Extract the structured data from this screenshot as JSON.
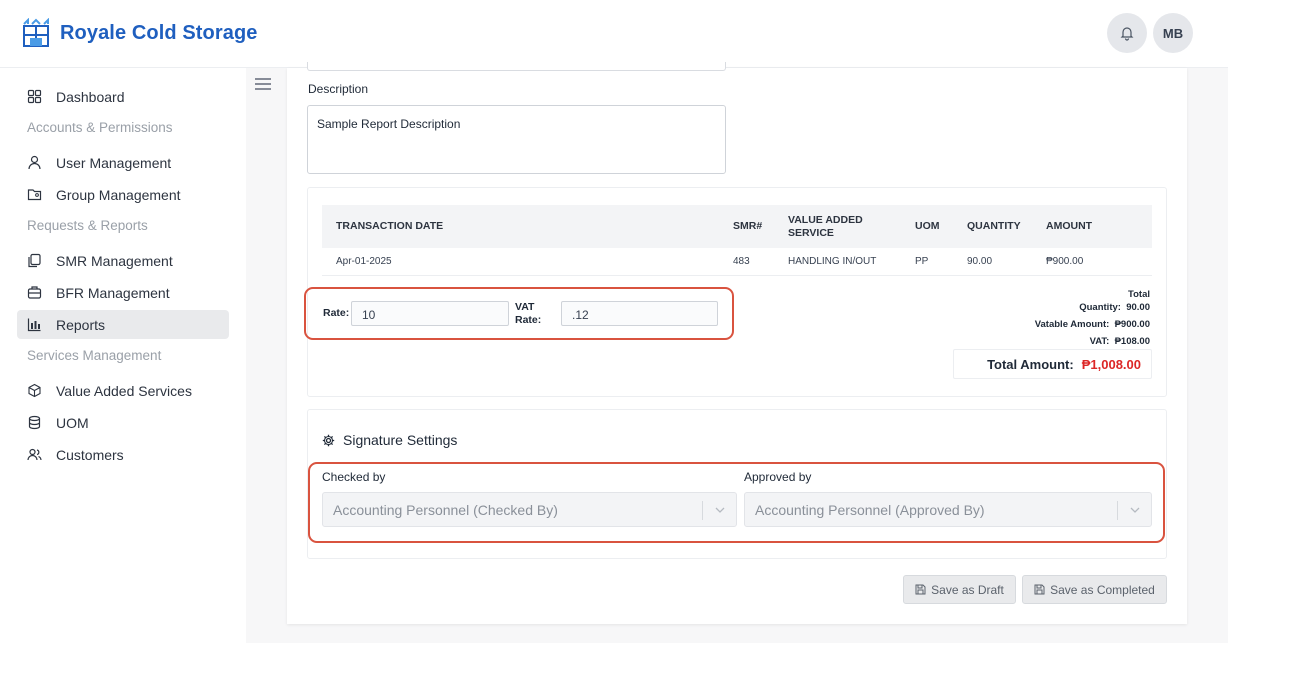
{
  "app": {
    "name": "Royale Cold Storage",
    "user_initials": "MB"
  },
  "sidebar": {
    "items": [
      {
        "label": "Dashboard",
        "icon": "dashboard-icon"
      },
      {
        "section": "Accounts & Permissions"
      },
      {
        "label": "User Management",
        "icon": "user-icon"
      },
      {
        "label": "Group Management",
        "icon": "folder-user-icon"
      },
      {
        "section": "Requests & Reports"
      },
      {
        "label": "SMR Management",
        "icon": "copy-icon"
      },
      {
        "label": "BFR Management",
        "icon": "briefcase-icon"
      },
      {
        "label": "Reports",
        "icon": "bar-chart-icon",
        "active": true
      },
      {
        "section": "Services Management"
      },
      {
        "label": "Value Added Services",
        "icon": "box-icon"
      },
      {
        "label": "UOM",
        "icon": "database-icon"
      },
      {
        "label": "Customers",
        "icon": "users-icon"
      }
    ]
  },
  "form": {
    "description_label": "Description",
    "description_value": "Sample Report Description"
  },
  "transactions": {
    "headers": [
      "TRANSACTION DATE",
      "SMR#",
      "VALUE ADDED SERVICE",
      "UOM",
      "QUANTITY",
      "AMOUNT"
    ],
    "rows": [
      [
        "Apr-01-2025",
        "483",
        "HANDLING IN/OUT",
        "PP",
        "90.00",
        "₱900.00"
      ]
    ]
  },
  "rates": {
    "rate_label": "Rate:",
    "rate_value": "10",
    "vat_label_line1": "VAT",
    "vat_label_line2": "Rate:",
    "vat_value": ".12"
  },
  "totals": {
    "total_quantity_label1": "Total",
    "total_quantity_label2": "Quantity:",
    "total_quantity": "90.00",
    "vatable_label": "Vatable Amount:",
    "vatable_amount": "₱900.00",
    "vat_label": "VAT:",
    "vat_amount": "₱108.00",
    "total_amount_label": "Total Amount:",
    "total_amount": "₱1,008.00"
  },
  "signature": {
    "title": "Signature Settings",
    "checked_by_label": "Checked by",
    "checked_by_value": "Accounting Personnel (Checked By)",
    "approved_by_label": "Approved by",
    "approved_by_value": "Accounting Personnel (Approved By)"
  },
  "actions": {
    "save_draft": "Save as Draft",
    "save_completed": "Save as Completed"
  },
  "colors": {
    "brand": "#1f5fbf",
    "highlight": "#d9533f",
    "total_amount": "#dc2626"
  }
}
